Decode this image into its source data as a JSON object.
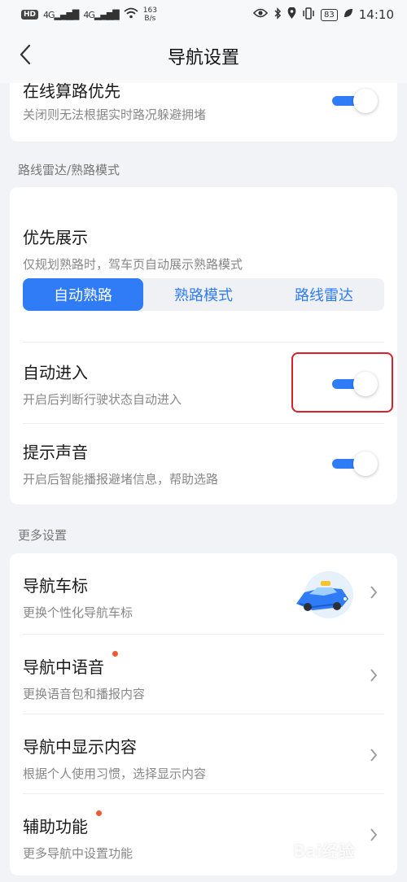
{
  "status_bar": {
    "hd": "HD",
    "sim1": "4G",
    "sim2": "4G",
    "speed_value": "163",
    "speed_unit": "B/s",
    "battery": "83",
    "time": "14:10"
  },
  "header": {
    "title": "导航设置"
  },
  "online_route": {
    "title": "在线算路优先",
    "subtitle": "关闭则无法根据实时路况躲避拥堵",
    "enabled": true
  },
  "section_radar": {
    "label": "路线雷达/熟路模式"
  },
  "priority_display": {
    "title": "优先展示",
    "subtitle": "仅规划熟路时，驾车页自动展示熟路模式",
    "options": [
      "自动熟路",
      "熟路模式",
      "路线雷达"
    ],
    "selected": "自动熟路"
  },
  "auto_enter": {
    "title": "自动进入",
    "subtitle": "开启后判断行驶状态自动进入",
    "enabled": true
  },
  "prompt_sound": {
    "title": "提示声音",
    "subtitle": "开启后智能播报避堵信息，帮助选路",
    "enabled": true
  },
  "section_more": {
    "label": "更多设置"
  },
  "more_items": [
    {
      "title": "导航车标",
      "subtitle": "更换个性化导航车标",
      "dot": false
    },
    {
      "title": "导航中语音",
      "subtitle": "更换语音包和播报内容",
      "dot": true
    },
    {
      "title": "导航中显示内容",
      "subtitle": "根据个人使用习惯，选择显示内容",
      "dot": false
    },
    {
      "title": "辅助功能",
      "subtitle": "更多导航中设置功能",
      "dot": true
    }
  ],
  "icons": {
    "back": "back-arrow-icon",
    "chevron": "chevron-right-icon",
    "car": "car-icon"
  },
  "colors": {
    "accent": "#2f7cf6",
    "highlight": "#d9202b",
    "dot": "#ef5a35"
  },
  "watermark": "Bai经验"
}
